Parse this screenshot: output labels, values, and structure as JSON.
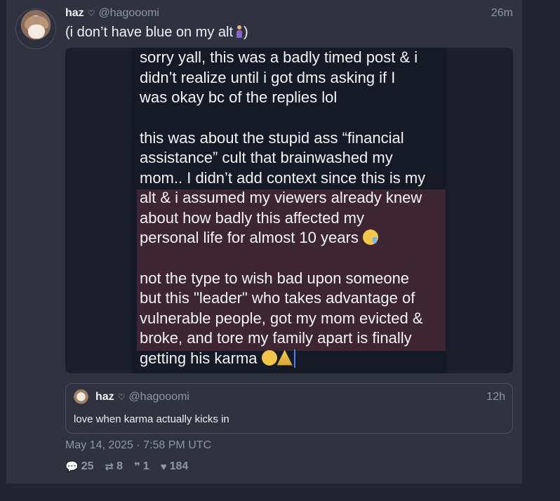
{
  "post": {
    "author_name": "haz",
    "heart": "♡",
    "handle": "@hagooomi",
    "time": "26m",
    "text": "(i don’t have blue on my alt",
    "text_suffix": ")",
    "avatar_icon": "avatar-anime",
    "date": "May 14, 2025 · 7:58 PM UTC"
  },
  "media": {
    "line1": "sorry yall, this was a badly timed post & i",
    "line2": "didn’t realize until i got dms asking if I",
    "line3": "was okay bc of the replies lol",
    "line4": "this was about the stupid ass “financial",
    "line5": "assistance” cult that brainwashed my",
    "line6": "mom.. I didn’t add context since this is my",
    "line7": "alt & i assumed my viewers already knew",
    "line8": "about how badly this affected my",
    "line9": "personal life for almost 10 years",
    "line10": "not the type to wish bad upon someone",
    "line11": "but this \"leader\" who takes advantage of",
    "line12": "vulnerable people, got my mom evicted &",
    "line13": "broke, and tore my family apart is finally",
    "line14": "getting his karma",
    "highlight_color": "#3d2531"
  },
  "quote": {
    "author_name": "haz",
    "heart": "♡",
    "handle": "@hagooomi",
    "time": "12h",
    "text": "love when karma actually kicks in"
  },
  "stats": {
    "replies": "25",
    "retweets": "8",
    "quotes": "1",
    "likes": "184",
    "reply_icon": "comment-icon",
    "retweet_icon": "retweet-icon",
    "quote_icon": "quote-icon",
    "like_icon": "heart-icon"
  }
}
